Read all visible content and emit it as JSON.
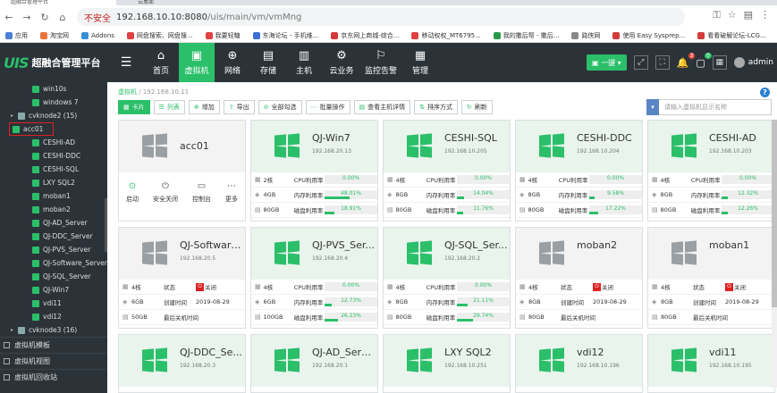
{
  "browser": {
    "tab1": "超融合管理平台",
    "tab2": "云桌面",
    "insecure": "不安全",
    "url_host": "192.168.10.10:8080",
    "url_path": "/uis/main/vm/vmMng",
    "bookmarks": [
      {
        "label": "应用",
        "color": "#4a7fd4"
      },
      {
        "label": "淘宝网",
        "color": "#e8733a"
      },
      {
        "label": "Addons",
        "color": "#3a8fd4"
      },
      {
        "label": "网盘搜索、网盘搜...",
        "color": "#e04040"
      },
      {
        "label": "我要轻糖",
        "color": "#e04040"
      },
      {
        "label": "东海论坛 - 手机维...",
        "color": "#3a6fd4"
      },
      {
        "label": "京东网上商城-综合...",
        "color": "#d43a3a"
      },
      {
        "label": "移动权权_MT6795...",
        "color": "#e04040"
      },
      {
        "label": "我的撒后帮 - 撒后...",
        "color": "#2a9a4a"
      },
      {
        "label": "路侠网",
        "color": "#888888"
      },
      {
        "label": "使用 Easy Sysprep...",
        "color": "#d43a3a"
      },
      {
        "label": "看看破解论坛-LCG...",
        "color": "#d43a3a"
      }
    ]
  },
  "header": {
    "logo_mark": "UIS",
    "logo_title": "超融合管理平台",
    "nav": [
      {
        "label": "首页",
        "icon": "⌂",
        "active": false
      },
      {
        "label": "虚拟机",
        "icon": "▣",
        "active": true
      },
      {
        "label": "网络",
        "icon": "⊕",
        "active": false
      },
      {
        "label": "存储",
        "icon": "▤",
        "active": false
      },
      {
        "label": "主机",
        "icon": "▥",
        "active": false
      },
      {
        "label": "云业务",
        "icon": "⚙",
        "active": false
      },
      {
        "label": "监控告警",
        "icon": "⚐",
        "active": false
      },
      {
        "label": "管理",
        "icon": "▦",
        "active": false
      }
    ],
    "one_click": "一键",
    "alerts_count": "3",
    "msg_count": "0",
    "user": "admin"
  },
  "sidebar": {
    "items": [
      {
        "label": "win10s",
        "type": "vm",
        "indent": 1
      },
      {
        "label": "windows 7",
        "type": "vm",
        "indent": 1
      },
      {
        "label": "cvknode2 (15)",
        "type": "host",
        "indent": 0
      },
      {
        "label": "acc01",
        "type": "vm",
        "indent": 1,
        "selected": true
      },
      {
        "label": "CESHI-AD",
        "type": "vm",
        "indent": 1
      },
      {
        "label": "CESHI-DDC",
        "type": "vm",
        "indent": 1
      },
      {
        "label": "CESHI-SQL",
        "type": "vm",
        "indent": 1
      },
      {
        "label": "LXY SQL2",
        "type": "vm",
        "indent": 1
      },
      {
        "label": "moban1",
        "type": "vm",
        "indent": 1
      },
      {
        "label": "moban2",
        "type": "vm",
        "indent": 1
      },
      {
        "label": "QJ-AD_Server",
        "type": "vm",
        "indent": 1
      },
      {
        "label": "QJ-DDC_Server",
        "type": "vm",
        "indent": 1
      },
      {
        "label": "QJ-PVS_Server",
        "type": "vm",
        "indent": 1
      },
      {
        "label": "QJ-Software_Server",
        "type": "vm",
        "indent": 1
      },
      {
        "label": "QJ-SQL_Server",
        "type": "vm",
        "indent": 1
      },
      {
        "label": "QJ-Win7",
        "type": "vm",
        "indent": 1
      },
      {
        "label": "vdi11",
        "type": "vm",
        "indent": 1
      },
      {
        "label": "vdi12",
        "type": "vm",
        "indent": 1
      },
      {
        "label": "cvknode3 (16)",
        "type": "host",
        "indent": 0
      }
    ],
    "sections": [
      "虚拟机模板",
      "虚拟机视图",
      "虚拟机回收站"
    ]
  },
  "main": {
    "crumb_root": "虚拟机",
    "crumb_sep": "/",
    "crumb_ip": "192.168.10.11",
    "toolbar": [
      {
        "label": "卡片",
        "icon": "▦",
        "active": true
      },
      {
        "label": "列表",
        "icon": "☰",
        "active": false
      },
      {
        "label": "增加",
        "icon": "⊕",
        "active": false
      },
      {
        "label": "导出",
        "icon": "⇪",
        "active": false
      },
      {
        "label": "全部勾选",
        "icon": "⊘",
        "active": false
      },
      {
        "label": "批量操作",
        "icon": "⋯",
        "active": false
      },
      {
        "label": "查看主机详情",
        "icon": "▤",
        "active": false
      },
      {
        "label": "排序方式",
        "icon": "⇅",
        "active": false
      },
      {
        "label": "刷新",
        "icon": "↻",
        "active": false
      }
    ],
    "search_placeholder": "请输入虚拟机显示名称"
  },
  "labels": {
    "cpu": "CPU利用率",
    "mem": "内存利用率",
    "disk": "磁盘利用率",
    "state": "状态",
    "created": "创建时间",
    "last_off": "最后关机时间",
    "off": "关闭"
  },
  "cards": [
    {
      "name": "acc01",
      "mode": "actions",
      "actions": [
        {
          "label": "启动",
          "icon": "⊙"
        },
        {
          "label": "安全关闭",
          "icon": "⏻"
        },
        {
          "label": "控制台",
          "icon": "▭"
        },
        {
          "label": "更多",
          "icon": "⋯"
        }
      ]
    },
    {
      "name": "QJ-Win7",
      "ip": "192.168.20.13",
      "mode": "running",
      "cpu_cores": "2核",
      "mem": "4GB",
      "disk": "80GB",
      "cpu_pct": "0.00%",
      "mem_pct": "48.01%",
      "disk_pct": "18.91%",
      "cpu_v": 0,
      "mem_v": 48.01,
      "disk_v": 18.91
    },
    {
      "name": "CESHI-SQL",
      "ip": "192.168.10.205",
      "mode": "running",
      "cpu_cores": "4核",
      "mem": "8GB",
      "disk": "80GB",
      "cpu_pct": "0.00%",
      "mem_pct": "14.04%",
      "disk_pct": "11.76%",
      "cpu_v": 0,
      "mem_v": 14.04,
      "disk_v": 11.76
    },
    {
      "name": "CESHI-DDC",
      "ip": "192.168.10.204",
      "mode": "running",
      "cpu_cores": "4核",
      "mem": "8GB",
      "disk": "80GB",
      "cpu_pct": "0.00%",
      "mem_pct": "9.58%",
      "disk_pct": "17.22%",
      "cpu_v": 0,
      "mem_v": 9.58,
      "disk_v": 17.22
    },
    {
      "name": "CESHI-AD",
      "ip": "192.168.10.203",
      "mode": "running",
      "cpu_cores": "4核",
      "mem": "8GB",
      "disk": "80GB",
      "cpu_pct": "0.00%",
      "mem_pct": "12.32%",
      "disk_pct": "12.26%",
      "cpu_v": 0,
      "mem_v": 12.32,
      "disk_v": 12.26
    },
    {
      "name": "QJ-Software...",
      "ip": "192.168.20.5",
      "mode": "stopped",
      "cpu_cores": "4核",
      "mem": "6GB",
      "disk": "50GB",
      "created": "2019-08-29"
    },
    {
      "name": "QJ-PVS_Ser...",
      "ip": "192.168.20.4",
      "mode": "running",
      "cpu_cores": "4核",
      "mem": "6GB",
      "disk": "100GB",
      "cpu_pct": "0.00%",
      "mem_pct": "12.73%",
      "disk_pct": "26.23%",
      "cpu_v": 0,
      "mem_v": 12.73,
      "disk_v": 26.23
    },
    {
      "name": "QJ-SQL_Ser...",
      "ip": "192.168.20.2",
      "mode": "running",
      "cpu_cores": "4核",
      "mem": "8GB",
      "disk": "80GB",
      "cpu_pct": "0.00%",
      "mem_pct": "21.11%",
      "disk_pct": "29.74%",
      "cpu_v": 0,
      "mem_v": 21.11,
      "disk_v": 29.74
    },
    {
      "name": "moban2",
      "ip": "",
      "mode": "stopped",
      "cpu_cores": "4核",
      "mem": "8GB",
      "disk": "80GB",
      "created": "2019-08-29"
    },
    {
      "name": "moban1",
      "ip": "",
      "mode": "stopped",
      "cpu_cores": "4核",
      "mem": "8GB",
      "disk": "80GB",
      "created": "2019-08-29"
    },
    {
      "name": "QJ-DDC_Se...",
      "ip": "192.168.20.3",
      "mode": "partial"
    },
    {
      "name": "QJ-AD_Server",
      "ip": "192.168.20.1",
      "mode": "partial"
    },
    {
      "name": "LXY SQL2",
      "ip": "192.168.10.251",
      "mode": "partial"
    },
    {
      "name": "vdi12",
      "ip": "192.168.10.196",
      "mode": "partial"
    },
    {
      "name": "vdi11",
      "ip": "192.168.10.195",
      "mode": "partial"
    }
  ]
}
